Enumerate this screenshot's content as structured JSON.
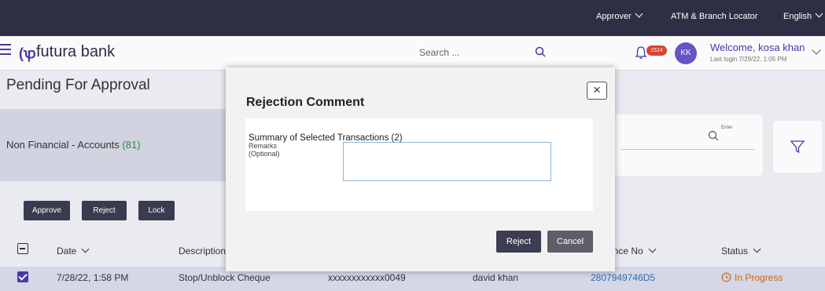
{
  "topbar": {
    "approver": "Approver",
    "locator": "ATM & Branch Locator",
    "language": "English"
  },
  "header": {
    "brand": "futura bank",
    "search_placeholder": "Search ...",
    "notification_count": "1524",
    "avatar_initials": "KK",
    "welcome": "Welcome, kosa khan",
    "last_login": "Last login 7/29/22, 1:05 PM"
  },
  "page": {
    "title": "Pending For Approval",
    "card_label": "Non Financial - Accounts",
    "card_count": "(81)",
    "search_enter": "Enter",
    "actions": {
      "approve": "Approve",
      "reject": "Reject",
      "lock": "Lock"
    },
    "columns": {
      "date": "Date",
      "description": "Description",
      "reference": "ence No",
      "status": "Status"
    },
    "row": {
      "date": "7/28/22, 1:58 PM",
      "description": "Stop/Unblock Cheque",
      "account": "xxxxxxxxxxxx0049",
      "user": "david khan",
      "reference": "2807949746D5",
      "status": "In Progress"
    }
  },
  "modal": {
    "title": "Rejection Comment",
    "close": "×",
    "summary": "Summary of Selected Transactions (2)",
    "remarks_label": "Remarks",
    "remarks_optional": "(Optional)",
    "remarks_value": "",
    "reject": "Reject",
    "cancel": "Cancel"
  }
}
